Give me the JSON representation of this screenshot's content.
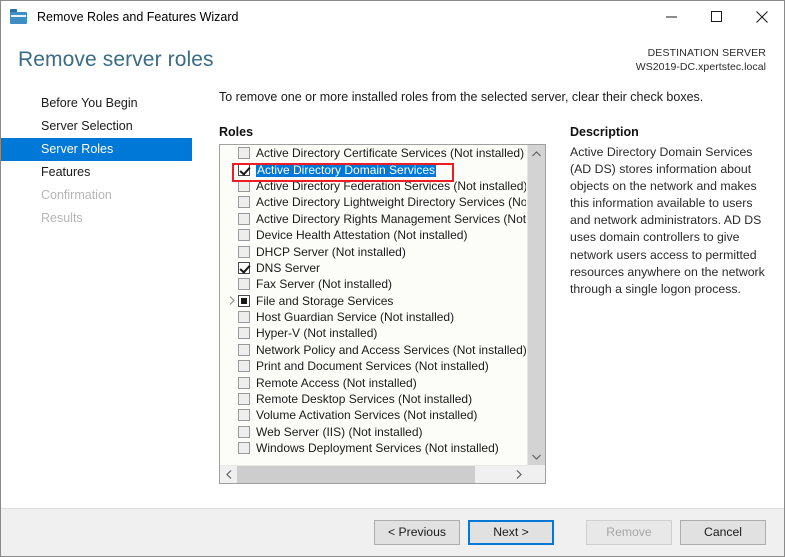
{
  "window": {
    "title": "Remove Roles and Features Wizard",
    "icon": "wizard-roles-icon",
    "minimize_label": "—",
    "maximize_label": "□",
    "close_label": "✕"
  },
  "header": {
    "page_heading": "Remove server roles",
    "destination_label": "DESTINATION SERVER",
    "destination_server": "WS2019-DC.xpertstec.local"
  },
  "sidebar": {
    "items": [
      {
        "label": "Before You Begin",
        "state": "normal"
      },
      {
        "label": "Server Selection",
        "state": "normal"
      },
      {
        "label": "Server Roles",
        "state": "selected"
      },
      {
        "label": "Features",
        "state": "normal"
      },
      {
        "label": "Confirmation",
        "state": "disabled"
      },
      {
        "label": "Results",
        "state": "disabled"
      }
    ]
  },
  "main": {
    "instruction": "To remove one or more installed roles from the selected server, clear their check boxes.",
    "roles_title": "Roles",
    "description_title": "Description",
    "description_text": "Active Directory Domain Services (AD DS) stores information about objects on the network and makes this information available to users and network administrators. AD DS uses domain controllers to give network users access to permitted resources anywhere on the network through a single logon process.",
    "roles": [
      {
        "label": "Active Directory Certificate Services (Not installed)",
        "checked": "unchecked",
        "selected": false,
        "expandable": false
      },
      {
        "label": "Active Directory Domain Services",
        "checked": "checked",
        "selected": true,
        "expandable": false
      },
      {
        "label": "Active Directory Federation Services (Not installed)",
        "checked": "unchecked",
        "selected": false,
        "expandable": false
      },
      {
        "label": "Active Directory Lightweight Directory Services (Not installed)",
        "checked": "unchecked",
        "selected": false,
        "expandable": false
      },
      {
        "label": "Active Directory Rights Management Services (Not installed)",
        "checked": "unchecked",
        "selected": false,
        "expandable": false
      },
      {
        "label": "Device Health Attestation (Not installed)",
        "checked": "unchecked",
        "selected": false,
        "expandable": false
      },
      {
        "label": "DHCP Server (Not installed)",
        "checked": "unchecked",
        "selected": false,
        "expandable": false
      },
      {
        "label": "DNS Server",
        "checked": "checked",
        "selected": false,
        "expandable": false
      },
      {
        "label": "Fax Server (Not installed)",
        "checked": "unchecked",
        "selected": false,
        "expandable": false
      },
      {
        "label": "File and Storage Services",
        "checked": "partial",
        "selected": false,
        "expandable": true
      },
      {
        "label": "Host Guardian Service (Not installed)",
        "checked": "unchecked",
        "selected": false,
        "expandable": false
      },
      {
        "label": "Hyper-V (Not installed)",
        "checked": "unchecked",
        "selected": false,
        "expandable": false
      },
      {
        "label": "Network Policy and Access Services (Not installed)",
        "checked": "unchecked",
        "selected": false,
        "expandable": false
      },
      {
        "label": "Print and Document Services (Not installed)",
        "checked": "unchecked",
        "selected": false,
        "expandable": false
      },
      {
        "label": "Remote Access (Not installed)",
        "checked": "unchecked",
        "selected": false,
        "expandable": false
      },
      {
        "label": "Remote Desktop Services (Not installed)",
        "checked": "unchecked",
        "selected": false,
        "expandable": false
      },
      {
        "label": "Volume Activation Services (Not installed)",
        "checked": "unchecked",
        "selected": false,
        "expandable": false
      },
      {
        "label": "Web Server (IIS) (Not installed)",
        "checked": "unchecked",
        "selected": false,
        "expandable": false
      },
      {
        "label": "Windows Deployment Services (Not installed)",
        "checked": "unchecked",
        "selected": false,
        "expandable": false
      }
    ]
  },
  "footer": {
    "previous_label": "< Previous",
    "next_label": "Next >",
    "remove_label": "Remove",
    "cancel_label": "Cancel"
  },
  "colors": {
    "accent": "#0078d7",
    "heading": "#3a6c84",
    "highlight_box": "#ee1c25",
    "list_background": "#fcfcf8"
  }
}
